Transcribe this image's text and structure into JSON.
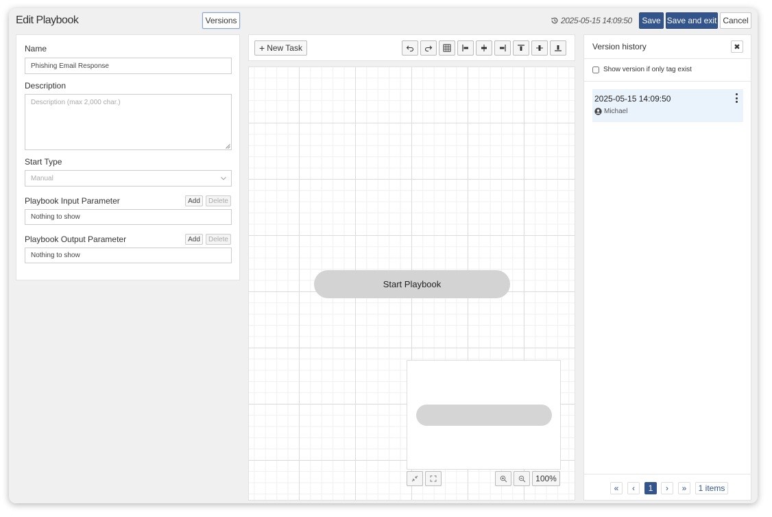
{
  "header": {
    "title": "Edit Playbook",
    "versions_label": "Versions",
    "timestamp": "2025-05-15 14:09:50",
    "save_label": "Save",
    "save_exit_label": "Save and exit",
    "cancel_label": "Cancel"
  },
  "form": {
    "name_label": "Name",
    "name_value": "Phishing Email Response",
    "description_label": "Description",
    "description_placeholder": "Description (max 2,000 char.)",
    "start_type_label": "Start Type",
    "start_type_value": "Manual",
    "input_param": {
      "label": "Playbook Input Parameter",
      "add_label": "Add",
      "delete_label": "Delete",
      "empty_text": "Nothing to show"
    },
    "output_param": {
      "label": "Playbook Output Parameter",
      "add_label": "Add",
      "delete_label": "Delete",
      "empty_text": "Nothing to show"
    }
  },
  "canvas": {
    "new_task_label": "New Task",
    "toolbar_icons": [
      "undo-icon",
      "redo-icon",
      "grid-icon",
      "align-left-icon",
      "align-center-icon",
      "align-right-icon",
      "align-top-icon",
      "align-middle-icon",
      "align-bottom-icon"
    ],
    "start_node_label": "Start Playbook",
    "zoom_level": "100%"
  },
  "version_history": {
    "title": "Version history",
    "close_label": "✖",
    "show_tag_only_label": "Show version if only tag exist",
    "items": [
      {
        "date": "2025-05-15 14:09:50",
        "user": "Michael"
      }
    ],
    "pagination": {
      "first": "«",
      "prev": "‹",
      "current": "1",
      "next": "›",
      "last": "»",
      "count": "1 items"
    }
  },
  "colors": {
    "primary": "#33558b",
    "selected_row": "#eaf2fc",
    "node_fill": "#d3d3d3"
  }
}
